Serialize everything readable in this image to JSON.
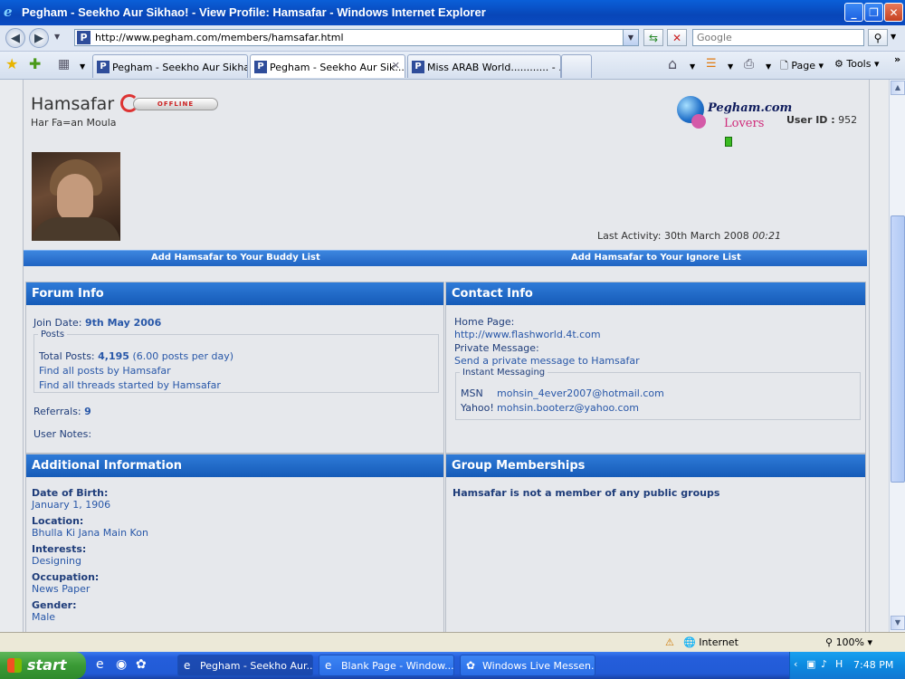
{
  "window": {
    "title": "Pegham - Seekho Aur Sikhao! - View Profile: Hamsafar - Windows Internet Explorer"
  },
  "address": {
    "url": "http://www.pegham.com/members/hamsafar.html",
    "search_placeholder": "Google"
  },
  "tabs": [
    {
      "label": "Pegham - Seekho Aur Sikhao...",
      "active": false
    },
    {
      "label": "Pegham - Seekho Aur Sik...",
      "active": true
    },
    {
      "label": "Miss ARAB World............ - ...",
      "active": false
    }
  ],
  "commands": {
    "page": "Page",
    "tools": "Tools"
  },
  "profile": {
    "username": "Hamsafar",
    "status": "OFFLINE",
    "user_title": "Har Fa=an Moula",
    "logo_line1": "Pegham.com",
    "logo_line2": "Lovers",
    "user_id_label": "User ID :",
    "user_id": "952",
    "last_activity_label": "Last Activity:",
    "last_activity_date": "30th March 2008",
    "last_activity_time": "00:21",
    "add_buddy": "Add Hamsafar to Your Buddy List",
    "add_ignore": "Add Hamsafar to Your Ignore List"
  },
  "forum_info": {
    "title": "Forum Info",
    "join_label": "Join Date:",
    "join_date": "9th May 2006",
    "posts_legend": "Posts",
    "total_posts_label": "Total Posts:",
    "total_posts": "4,195",
    "posts_per_day": "(6.00 posts per day)",
    "find_posts": "Find all posts by Hamsafar",
    "find_threads": "Find all threads started by Hamsafar",
    "referrals_label": "Referrals:",
    "referrals": "9",
    "user_notes": "User Notes:"
  },
  "contact_info": {
    "title": "Contact Info",
    "homepage_label": "Home Page:",
    "homepage": "http://www.flashworld.4t.com",
    "pm_label": "Private Message:",
    "pm_link": "Send a private message to Hamsafar",
    "im_legend": "Instant Messaging",
    "msn_label": "MSN",
    "msn": "mohsin_4ever2007@hotmail.com",
    "yahoo_label": "Yahoo!",
    "yahoo": "mohsin.booterz@yahoo.com"
  },
  "additional": {
    "title": "Additional Information",
    "fields": [
      {
        "label": "Date of Birth:",
        "value": "January 1, 1906"
      },
      {
        "label": "Location:",
        "value": "Bhulla Ki Jana Main Kon"
      },
      {
        "label": "Interests:",
        "value": "Designing"
      },
      {
        "label": "Occupation:",
        "value": "News Paper"
      },
      {
        "label": "Gender:",
        "value": "Male"
      }
    ]
  },
  "groups": {
    "title": "Group Memberships",
    "message": "Hamsafar is not a member of any public groups"
  },
  "statusbar": {
    "zone": "Internet",
    "zoom": "100%"
  },
  "taskbar": {
    "start": "start",
    "buttons": [
      {
        "label": "Pegham - Seekho Aur...",
        "active": true
      },
      {
        "label": "Blank Page - Window...",
        "active": false
      },
      {
        "label": "Windows Live Messen...",
        "active": false
      }
    ],
    "clock": "7:48 PM"
  }
}
